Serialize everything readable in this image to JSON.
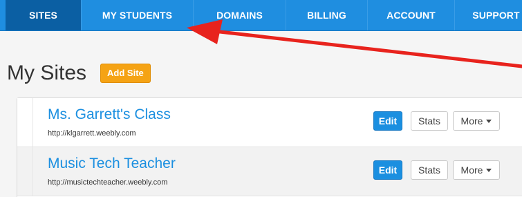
{
  "nav": {
    "items": [
      {
        "label": "SITES",
        "active": true
      },
      {
        "label": "MY STUDENTS",
        "active": false
      },
      {
        "label": "DOMAINS",
        "active": false
      },
      {
        "label": "BILLING",
        "active": false
      },
      {
        "label": "ACCOUNT",
        "active": false
      },
      {
        "label": "SUPPORT",
        "active": false
      }
    ]
  },
  "page": {
    "title": "My Sites",
    "add_site_label": "Add Site"
  },
  "sites": [
    {
      "name": "Ms. Garrett's Class",
      "url": "http://klgarrett.weebly.com",
      "edit_label": "Edit",
      "stats_label": "Stats",
      "more_label": "More"
    },
    {
      "name": "Music Tech Teacher",
      "url": "http://musictechteacher.weebly.com",
      "edit_label": "Edit",
      "stats_label": "Stats",
      "more_label": "More"
    }
  ],
  "colors": {
    "nav_bg": "#1f8ee0",
    "nav_active": "#0b5fa3",
    "accent_orange": "#f5a314",
    "link_blue": "#1b8fe0",
    "annotation_red": "#e8231d"
  },
  "annotation": {
    "icon": "red-pointer-arrow"
  }
}
